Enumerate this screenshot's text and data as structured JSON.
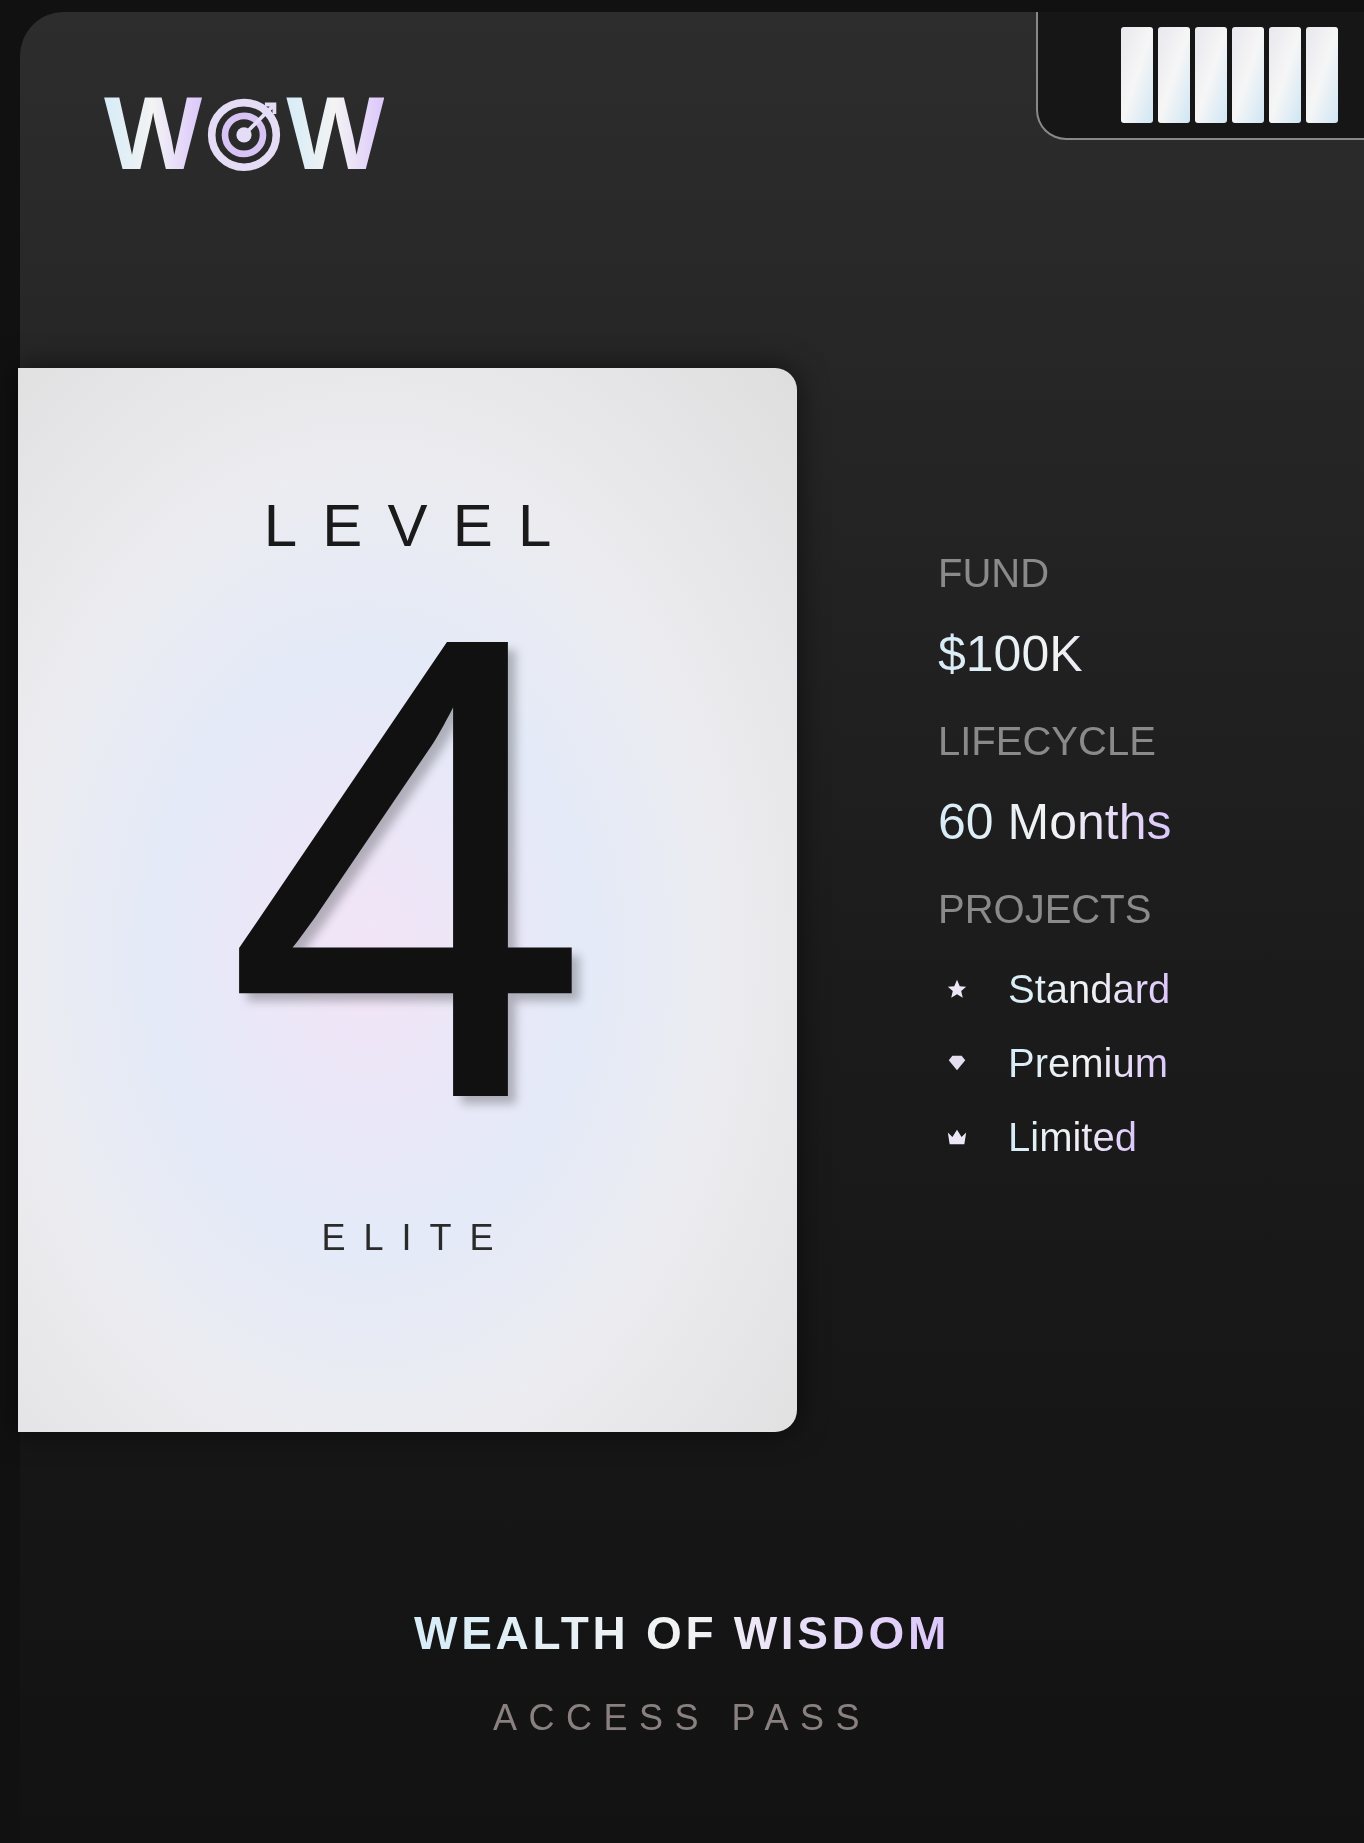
{
  "logo": {
    "left": "W",
    "right": "W"
  },
  "badge": {
    "level": "LEVEL",
    "number": "4",
    "tier": "ELITE"
  },
  "details": [
    {
      "label": "FUND",
      "value": "$100K"
    },
    {
      "label": "LIFECYCLE",
      "value": "60 Months"
    }
  ],
  "projects": {
    "label": "PROJECTS",
    "items": [
      {
        "kind": "star",
        "name": "Standard"
      },
      {
        "kind": "diamond",
        "name": "Premium"
      },
      {
        "kind": "crown",
        "name": "Limited"
      }
    ]
  },
  "footer": {
    "title": "WEALTH OF WISDOM",
    "subtitle": "ACCESS PASS"
  }
}
